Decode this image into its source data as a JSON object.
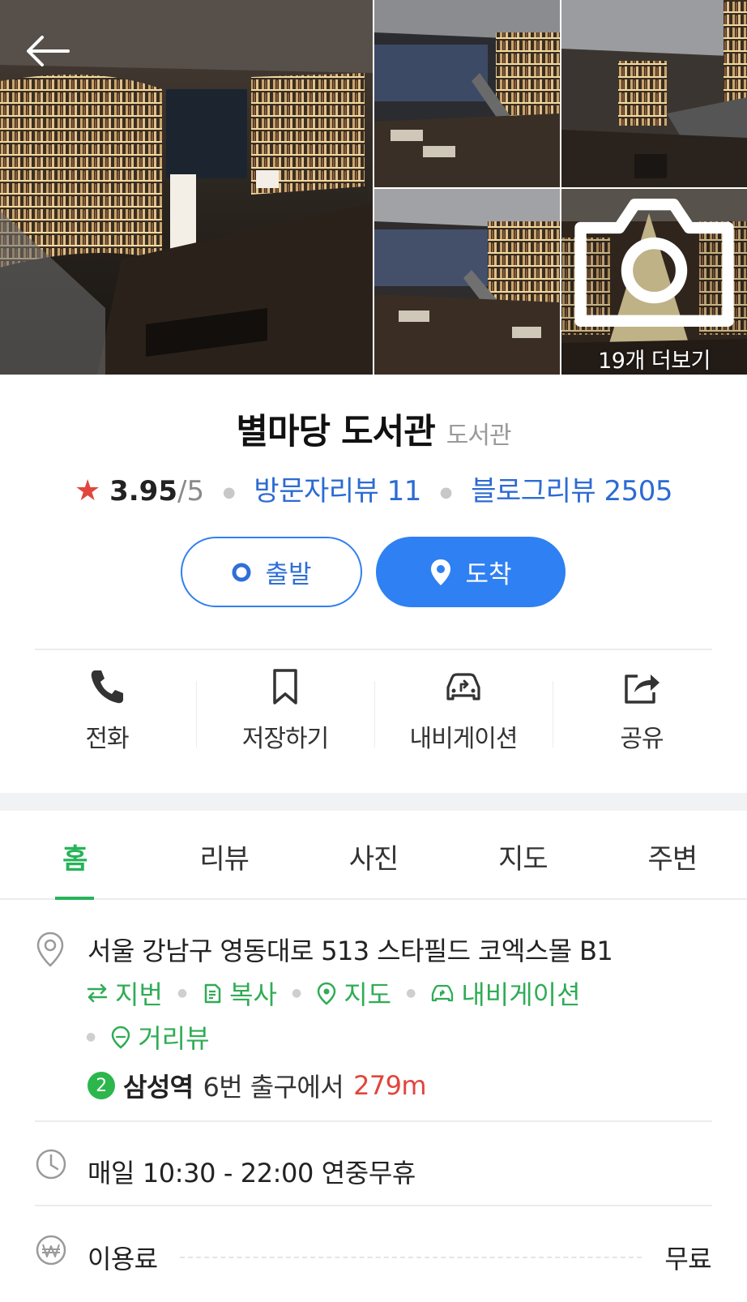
{
  "gallery": {
    "more_label": "19개 더보기",
    "back_icon": "arrow-left-icon",
    "camera_icon": "camera-icon"
  },
  "place": {
    "name": "별마당 도서관",
    "category": "도서관",
    "rating": "3.95",
    "rating_max": "/5",
    "visitor_reviews": "방문자리뷰 11",
    "blog_reviews": "블로그리뷰 2505"
  },
  "route": {
    "depart_label": "출발",
    "arrive_label": "도착"
  },
  "actions": [
    {
      "label": "전화",
      "icon": "phone-icon"
    },
    {
      "label": "저장하기",
      "icon": "bookmark-icon"
    },
    {
      "label": "내비게이션",
      "icon": "car-navigation-icon"
    },
    {
      "label": "공유",
      "icon": "share-icon"
    }
  ],
  "tabs": [
    {
      "label": "홈",
      "active": true
    },
    {
      "label": "리뷰",
      "active": false
    },
    {
      "label": "사진",
      "active": false
    },
    {
      "label": "지도",
      "active": false
    },
    {
      "label": "주변",
      "active": false
    }
  ],
  "info": {
    "address": "서울 강남구 영동대로 513 스타필드 코엑스몰 B1",
    "links": {
      "lot": "지번",
      "copy": "복사",
      "map": "지도",
      "navigation": "내비게이션",
      "street_view": "거리뷰"
    },
    "subway": {
      "line": "2",
      "station": "삼성역",
      "exit": "6번 출구에서",
      "distance": "279m"
    },
    "hours": "매일 10:30 - 22:00 연중무휴",
    "fee_label": "이용료",
    "fee_value": "무료"
  },
  "colors": {
    "accent_blue": "#2f80f2",
    "link_blue": "#2c6bd3",
    "accent_green": "#27b35a",
    "star_red": "#e2453c"
  }
}
